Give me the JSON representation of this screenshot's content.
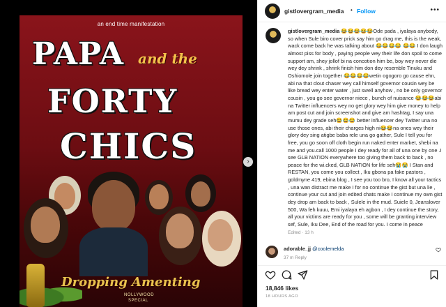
{
  "post": {
    "tagline": "an end time manifestation",
    "title_line1": "PAPA",
    "title_and": "and the",
    "title_line2": "FORTY",
    "title_line3": "CHICS",
    "footer_title": "Dropping Amenting",
    "footer_sub1": "NOLLYWOOD",
    "footer_sub2": "SPECIAL"
  },
  "header": {
    "username": "gistlovergram_media",
    "separator": "•",
    "follow_label": "Follow",
    "more_label": "•••"
  },
  "caption": {
    "username": "gistlovergram_media",
    "text": "😂😂😂😂😂Ode pada , iyalaya anybody, so when Sule biro cover prick say him go drag me, this is the weak, wack come back he was talking about 😂😂😂😂 😂😂 I don laugh almost piss for body , paying people wey their life don spoil to come support am, shey jollof bi na concotion him be, boy wey never die wey dey shrink , shrink finish him don dey resemble Tinuku and Oshiomole join together 😂😂😂😂wetin ogogoro go cause ehn, abi na that clout chaser wey call himself governor cousin wey be like bread wey enter water , just swell anyhow , no be only governor cousin , you go see governor niece , bunch of nuisance 😂😂😂abi na Twitter influencers wey no get glory wey him give money to help am post cut and join screenshot and give am hashtag, I say una mumu dey grade seh😂😂😂 better influencer dey Twitter una no use those ones, abi their charges high ni😂😂na ones wey their glory dey sing atigbe baba rele una go gather, Sule I tell you for free, you go soon off cloth begin run naked enter market, shebi na me and you.call 1000 people I dey ready for all of una one by one .I see GLB NATION everywhere too giving them back to back , no peace for the wi.cked, GLB NATION for life seh😭😭 I Stan and RESTAN, you come you collect , Iku gbona pa fake pastors , goldmyne 419, ebina blog , I see you too bro, I know all your tactics , una wan distract me make I for no continue the gist but una lie , continue your cut and join edited chats make I continue my own gist dey drop am back to back , Sulele in the mud. Suiele 0, Jeanslover 500, Wa feh kuuu, Emi iyalaya eh agbon , I dey continue the story, all your victims are ready for you , some will be granting interview sef, Sule, Iku Dee, End of the road for you. I come in peace",
    "edited": "Edited · 13 h"
  },
  "comment": {
    "username": "adorable_jj",
    "mention": "@coolemelda",
    "meta": "37 m   Reply"
  },
  "engagement": {
    "likes": "18,846 likes",
    "time": "18 HOURS AGO"
  },
  "colors": {
    "accent": "#0095f6",
    "muted": "#8e8e8e",
    "poster_red": "#6e0f14",
    "poster_gold": "#e9c24d"
  },
  "icons": [
    "more-icon",
    "heart-icon",
    "comment-icon",
    "share-icon",
    "bookmark-icon",
    "chevron-right-icon"
  ]
}
